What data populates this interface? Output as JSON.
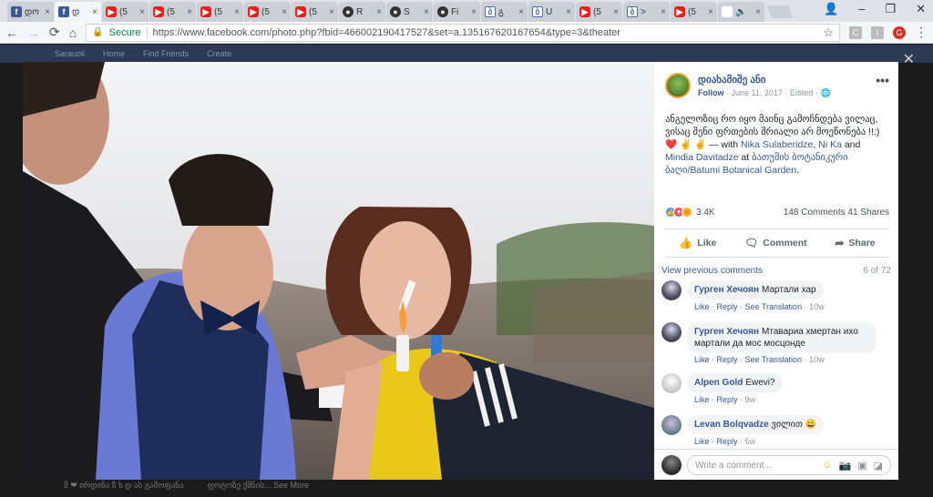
{
  "browser": {
    "tabs": [
      {
        "favicon": "facebook-icon",
        "title": "დო",
        "active": false,
        "close": "×"
      },
      {
        "favicon": "facebook-icon",
        "title": "დ",
        "active": true,
        "close": "×"
      },
      {
        "favicon": "youtube-icon",
        "title": "(5",
        "active": false,
        "close": "×"
      },
      {
        "favicon": "youtube-icon",
        "title": "(5",
        "active": false,
        "close": "×"
      },
      {
        "favicon": "youtube-icon",
        "title": "(5",
        "active": false,
        "close": "×"
      },
      {
        "favicon": "youtube-icon",
        "title": "(5",
        "active": false,
        "close": "×"
      },
      {
        "favicon": "youtube-icon",
        "title": "(5",
        "active": false,
        "close": "×"
      },
      {
        "favicon": "github-icon",
        "title": "R",
        "active": false,
        "close": "×"
      },
      {
        "favicon": "github-icon",
        "title": "S",
        "active": false,
        "close": "×"
      },
      {
        "favicon": "github-icon",
        "title": "Fi",
        "active": false,
        "close": "×"
      },
      {
        "favicon": "bookmark-icon",
        "title": "გ",
        "active": false,
        "close": "×"
      },
      {
        "favicon": "bookmark-icon",
        "title": "U",
        "active": false,
        "close": "×"
      },
      {
        "favicon": "youtube-icon",
        "title": "(5",
        "active": false,
        "close": "×"
      },
      {
        "favicon": "bookmark-icon",
        "title": ">",
        "active": false,
        "close": "×"
      },
      {
        "favicon": "youtube-icon",
        "title": "(5",
        "active": false,
        "close": "×"
      },
      {
        "favicon": "speaker-icon",
        "title": "🔈",
        "active": false,
        "close": "×"
      }
    ],
    "window_controls": {
      "user": "👤",
      "minimize": "–",
      "restore": "❐",
      "close": "✕"
    },
    "nav": {
      "back": "←",
      "forward": "→",
      "reload": "⟳",
      "home": "⌂"
    },
    "secure_label": "Secure",
    "url": "https://www.facebook.com/photo.php?fbid=466002190417527&set=a.135167620167654&type=3&theater",
    "star": "☆",
    "extensions": [
      "C",
      "I",
      "G"
    ],
    "menu": "⋮"
  },
  "fb_background": {
    "menu_items": [
      "Sarauoli",
      "Home",
      "Find Friends",
      "Create"
    ],
    "bottom_text": [
      "მ ❤ ირდინა ზ ხ დ ას გამოფანა",
      "ფოტოზე ქმნის...  See More"
    ],
    "close_viewer": "✕"
  },
  "post": {
    "author": "დიახამიშე ანი",
    "follow": "Follow",
    "date": "June 11, 2017",
    "edited": "Edited",
    "more": "•••",
    "caption": "ანგელოზიც რო იყო მაინც გამოჩნდება ვილაც, ვისაც შენი ფრთების შრიალი არ მოეწონება !!:)",
    "caption_emoji": "❤️ ✌ ✌",
    "with_prefix": "— with",
    "tag1": "Nika Sulaberidze",
    "tag2": "Ni Ka",
    "and": "and",
    "tag3": "Mindia Davitadze",
    "at": "at",
    "place": "ბათუმის ბოტანიკური ბაღი/Batumi Botanical Garden",
    "reactions_count": "3.4K",
    "comments_count": "148 Comments",
    "shares_count": "41 Shares",
    "like_label": "Like",
    "comment_label": "Comment",
    "share_label": "Share"
  },
  "comments_meta": {
    "view_previous": "View previous comments",
    "pager": "6 of 72"
  },
  "comments": [
    {
      "name": "Гурген Хечоян",
      "text": "Мартали хар",
      "like": "Like",
      "reply": "Reply",
      "see_translation": "See Translation",
      "time": "10w"
    },
    {
      "name": "Гурген Хечоян",
      "text": "Мтавариа хмертан ихо мартали да мос мосцонде",
      "like": "Like",
      "reply": "Reply",
      "see_translation": "See Translation",
      "time": "10w"
    },
    {
      "name": "Alpen Gold",
      "text": "Ewevi?",
      "like": "Like",
      "reply": "Reply",
      "time": "9w"
    },
    {
      "name": "Levan Bolqvadze",
      "text": "ვილით 😀",
      "like": "Like",
      "reply": "Reply",
      "time": "5w"
    }
  ],
  "composer": {
    "placeholder": "Write a comment...",
    "icons": [
      "smiley-icon",
      "camera-icon",
      "gif-icon",
      "sticker-icon"
    ]
  },
  "colors": {
    "fb_blue": "#365899",
    "secure_green": "#0b8043",
    "like_blue": "#5890ff",
    "love_red": "#f25268",
    "haha_yellow": "#f7b125"
  }
}
